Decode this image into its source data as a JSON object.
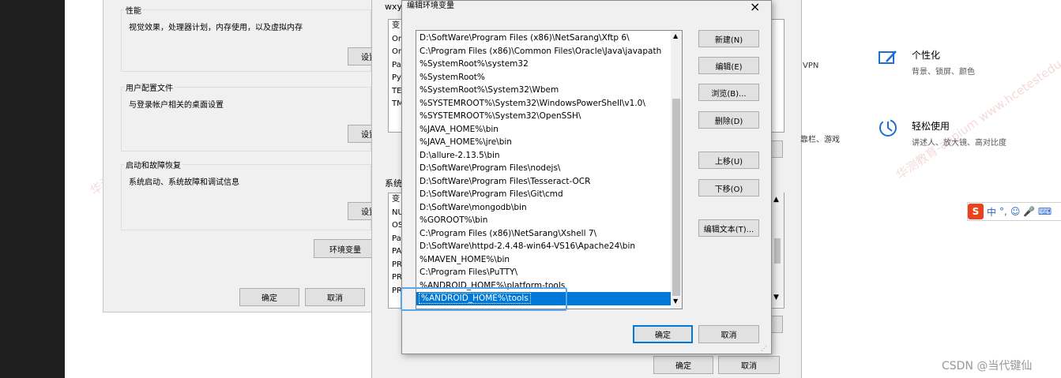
{
  "watermark": "华测教育-appium  www.hcetestedu.com",
  "system_properties": {
    "groups": [
      {
        "title": "性能",
        "desc": "视觉效果，处理器计划，内存使用，以及虚拟内存",
        "button": "设置"
      },
      {
        "title": "用户配置文件",
        "desc": "与登录帐户相关的桌面设置",
        "button": "设置"
      },
      {
        "title": "启动和故障恢复",
        "desc": "系统启动、系统故障和调试信息",
        "button": "设置"
      }
    ],
    "env_button": "环境变量",
    "ok": "确定",
    "cancel": "取消"
  },
  "env_vars": {
    "user_label": "wxy",
    "user_rows": [
      "变",
      "On",
      "On",
      "Pa",
      "Py",
      "TE",
      "TM"
    ],
    "system_label": "系统",
    "system_rows": [
      "变",
      "NU",
      "OS",
      "Pa",
      "PA",
      "PR",
      "PR",
      "PR"
    ],
    "ok": "确定",
    "cancel": "取消"
  },
  "edit_dialog": {
    "title": "编辑环境变量",
    "close": "×",
    "paths": [
      "D:\\SoftWare\\Program Files (x86)\\NetSarang\\Xftp 6\\",
      "C:\\Program Files (x86)\\Common Files\\Oracle\\Java\\javapath",
      "%SystemRoot%\\system32",
      "%SystemRoot%",
      "%SystemRoot%\\System32\\Wbem",
      "%SYSTEMROOT%\\System32\\WindowsPowerShell\\v1.0\\",
      "%SYSTEMROOT%\\System32\\OpenSSH\\",
      "%JAVA_HOME%\\bin",
      "%JAVA_HOME%\\jre\\bin",
      "D:\\allure-2.13.5\\bin",
      "D:\\SoftWare\\Program Files\\nodejs\\",
      "D:\\SoftWare\\Program Files\\Tesseract-OCR",
      "D:\\SoftWare\\Program Files\\Git\\cmd",
      "D:\\SoftWare\\mongodb\\bin",
      "%GOROOT%\\bin",
      "C:\\Program Files (x86)\\NetSarang\\Xshell 7\\",
      "D:\\SoftWare\\httpd-2.4.48-win64-VS16\\Apache24\\bin",
      "%MAVEN_HOME%\\bin",
      "C:\\Program Files\\PuTTY\\",
      "%ANDROID_HOME%\\platform-tools",
      "%ANDROID_HOME%\\tools"
    ],
    "selected_index": 20,
    "buttons": {
      "new": "新建(N)",
      "edit": "编辑(E)",
      "browse": "浏览(B)...",
      "delete": "删除(D)",
      "move_up": "上移(U)",
      "move_down": "下移(O)",
      "edit_text": "编辑文本(T)..."
    },
    "ok": "确定",
    "cancel": "取消"
  },
  "settings": {
    "vpn": "VPN",
    "games_fragment": "靠栏、游戏",
    "personalization": {
      "title": "个性化",
      "sub": "背景、锁屏、颜色"
    },
    "ease_of_access": {
      "title": "轻松使用",
      "sub": "讲述人、放大镜、高对比度"
    }
  },
  "ime_bar": {
    "logo": "S",
    "lang": "中",
    "punct": "°,",
    "icons": "☺ 🎤 ⌨"
  },
  "footer": "CSDN @当代键仙"
}
